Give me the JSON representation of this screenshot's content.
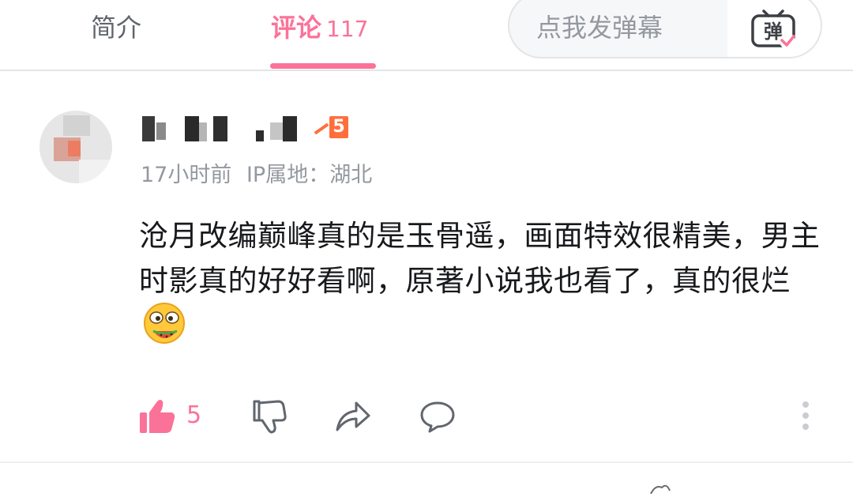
{
  "tabs": {
    "intro_label": "简介",
    "comments_label": "评论",
    "comments_count": "117"
  },
  "danmaku": {
    "placeholder": "点我发弹幕",
    "toggle_label": "弹"
  },
  "comment": {
    "level": "5",
    "time": "17小时前",
    "ip_location": "IP属地：湖北",
    "text": "沧月改编巅峰真的是玉骨遥，画面特效很精美，男主时影真的好好看啊，原著小说我也看了，真的很烂",
    "emoji": "watermelon-eating-face-emoji",
    "like_count": "5"
  },
  "colors": {
    "accent": "#fb7299",
    "level_badge": "#ff6f3c",
    "muted_text": "#9499a0"
  }
}
